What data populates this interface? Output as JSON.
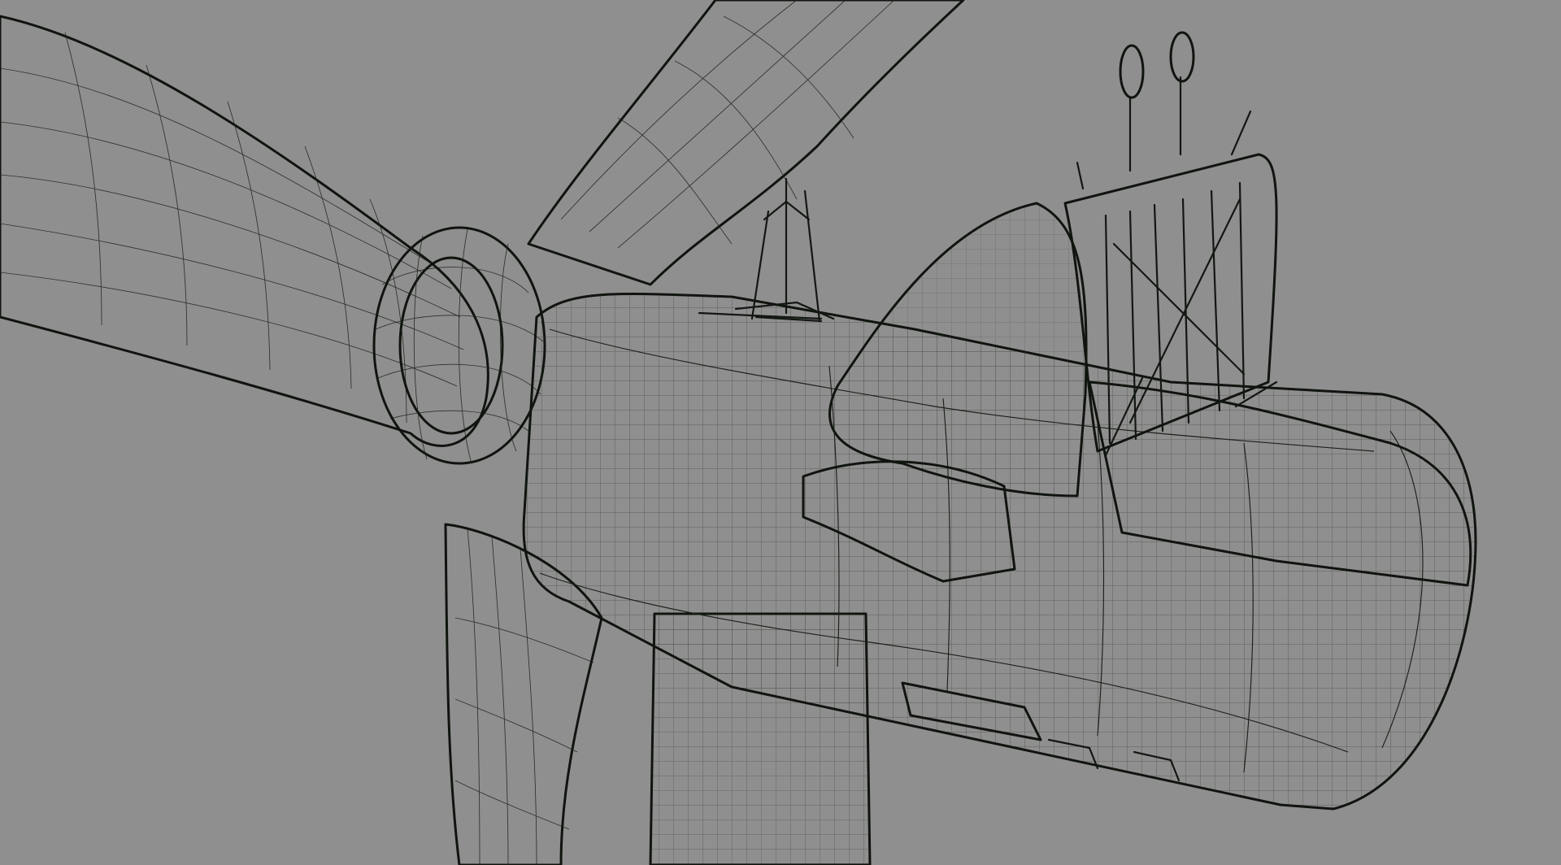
{
  "viewport": {
    "background": "#8f8f8f",
    "render_style": "smooth-shade with wireframe on shaded",
    "model_color": "#8fa08a",
    "model_shadow_color": "#53604f",
    "wire_color": "#1b2119"
  },
  "model": {
    "parts": [
      "rotor-blade-left",
      "rotor-blade-top",
      "rotor-blade-bottom",
      "rotor-hub",
      "nacelle-body",
      "tower",
      "rear-cooler-frame",
      "top-lightning-rod",
      "anemometer-masts"
    ]
  }
}
